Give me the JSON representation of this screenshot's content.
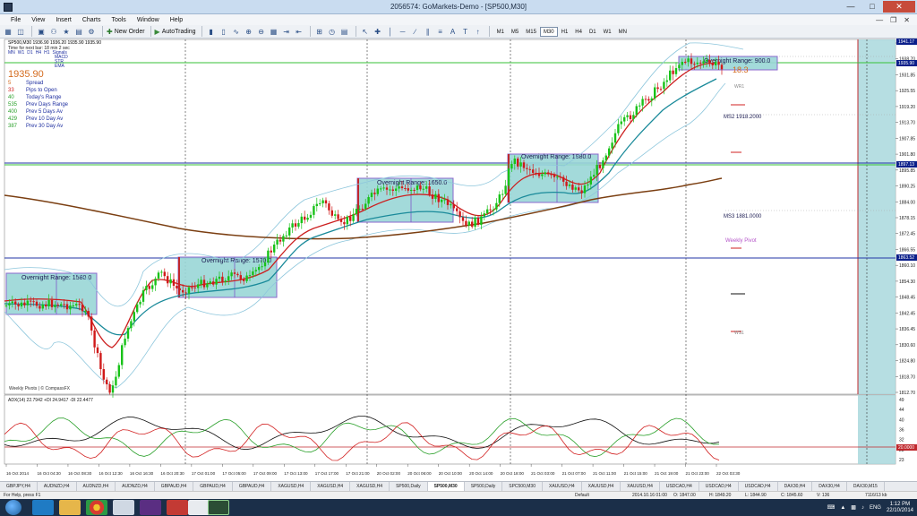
{
  "window": {
    "title": "2056574: GoMarkets-Demo - [SP500,M30]"
  },
  "menu": [
    "File",
    "View",
    "Insert",
    "Charts",
    "Tools",
    "Window",
    "Help"
  ],
  "toolbar": {
    "new_order": "New Order",
    "autotrading": "AutoTrading",
    "timeframes": [
      "M1",
      "M5",
      "M15",
      "M30",
      "H1",
      "H4",
      "D1",
      "W1",
      "MN"
    ],
    "active_timeframe": "M30"
  },
  "chart": {
    "header": "SP500,M30  1936.90 1936.20 1935.90 1935.90",
    "next_bar": "Time for next bar: 18 min 2 sec",
    "indicators_row": [
      "MN",
      "W1",
      "D1",
      "H4",
      "H1",
      "Signals"
    ],
    "indicators": [
      "MACD",
      "STR",
      "EMA"
    ],
    "bid": "1935.90",
    "info_rows": [
      {
        "value": "5",
        "label": "Spread"
      },
      {
        "value": "33",
        "label": "Pips to Open"
      },
      {
        "value": "40",
        "label": "Today's Range"
      },
      {
        "value": "535",
        "label": "Prev Days Range"
      },
      {
        "value": "400",
        "label": "Prev 5 Days Av"
      },
      {
        "value": "429",
        "label": "Prev 10 Day Av"
      },
      {
        "value": "387",
        "label": "Prev 30 Day Av"
      }
    ],
    "overnight_ranges": [
      "Overnight Range: 1580.0",
      "Overnight Range: 1570.0",
      "Overnight Range: 1650.0",
      "Overnight Range: 1880.0",
      "Overnight Range: 900.0"
    ],
    "pivot_labels": [
      "MS2   1918.2000",
      "MS3   1881.0000",
      "Weekly Pivot",
      "WR1",
      "WS1"
    ],
    "small_value": "18.3",
    "watermark": "Weekly Pivots | © CompassFX",
    "price_scale": [
      "1944.95",
      "1938.70",
      "1931.85",
      "1925.55",
      "1919.20",
      "1913.70",
      "1907.85",
      "1901.80",
      "1895.85",
      "1890.25",
      "1884.00",
      "1878.15",
      "1872.45",
      "1866.55",
      "1860.10",
      "1854.30",
      "1848.45",
      "1842.45",
      "1836.45",
      "1830.60",
      "1824.80",
      "1818.70",
      "1812.70"
    ],
    "price_tags": [
      {
        "label": "1941.17",
        "color": "#0b1f8a"
      },
      {
        "label": "1935.90",
        "color": "#0b1f8a"
      },
      {
        "label": "1897.13",
        "color": "#0b1f8a"
      },
      {
        "label": "1863.52",
        "color": "#0b1f8a"
      }
    ],
    "time_labels": [
      "16 Oct 2014",
      "16 Oct 04:30",
      "16 Oct 08:30",
      "16 Oct 12:30",
      "16 Oct 16:30",
      "16 Oct 20:30",
      "17 Oct 01:00",
      "17 Oct 05:00",
      "17 Oct 09:00",
      "17 Oct 13:00",
      "17 Oct 17:00",
      "17 Oct 21:00",
      "20 Oct 02:00",
      "20 Oct 06:00",
      "20 Oct 10:00",
      "20 Oct 14:00",
      "20 Oct 18:00",
      "21 Oct 03:00",
      "21 Oct 07:00",
      "21 Oct 11:00",
      "21 Oct 15:00",
      "21 Oct 19:00",
      "21 Oct 23:00",
      "22 Oct 03:30"
    ]
  },
  "sub_chart": {
    "label": "ADX(14) 22.7942 +DI 24.9417 -DI 22.4477",
    "scale": [
      "49",
      "44",
      "40",
      "36",
      "32",
      "28",
      "23"
    ],
    "level_tag": "20.0000"
  },
  "tabs": [
    "GBPJPY,H4",
    "AUDNZD,H4",
    "AUDNZD,H4",
    "AUDNZD,H4",
    "GBPAUD,H4",
    "GBPAUD,H4",
    "GBPAUD,H4",
    "XAGUSD,H4",
    "XAGUSD,H4",
    "XAGUSD,H4",
    "SP500,Daily",
    "SP500,M30",
    "SP500,Daily",
    "SPC500,M30",
    "XAUUSD,H4",
    "XAUUSD,H4",
    "XAUUSD,H4",
    "USDCAD,H4",
    "USDCAD,H4",
    "USDCAD,H4",
    "DAX30,H4",
    "DAX30,H4",
    "DAX30,M15"
  ],
  "active_tab": "SP500,M30",
  "status": {
    "help": "For Help, press F1",
    "profile": "Default",
    "time": "2014.10.16 01:00",
    "open": "O: 1847.00",
    "high": "H: 1849.20",
    "low": "L: 1844.90",
    "close": "C: 1845.60",
    "volume": "V: 136",
    "traffic": "7116/13 kb"
  },
  "taskbar": {
    "language": "ENG",
    "time": "1:12 PM",
    "date": "22/10/2014"
  }
}
